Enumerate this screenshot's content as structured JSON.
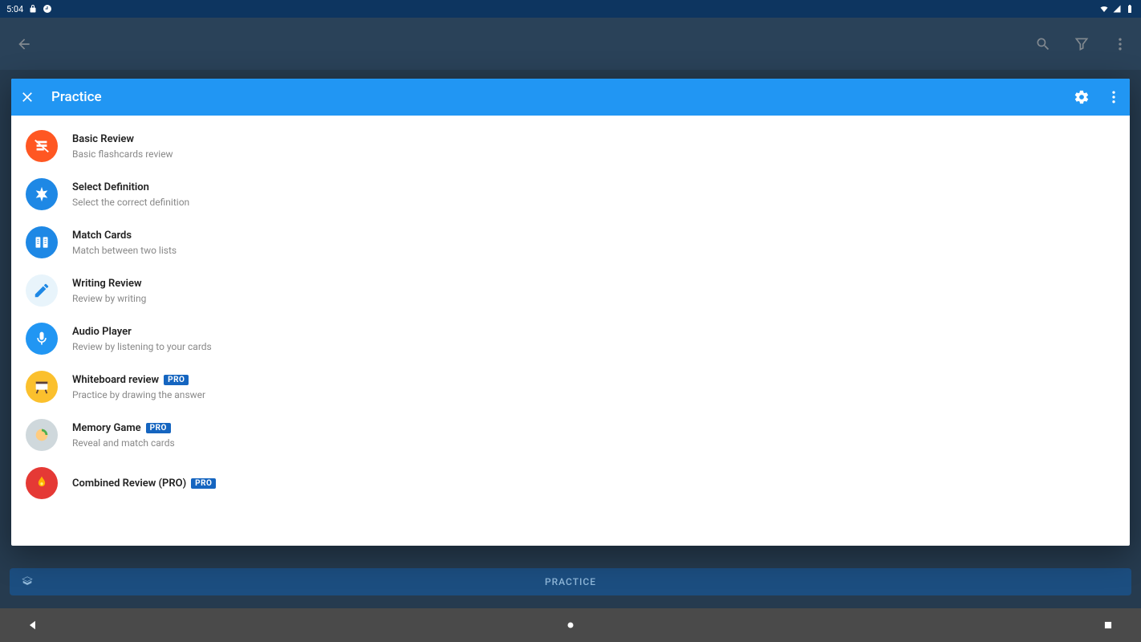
{
  "status": {
    "time": "5:04"
  },
  "dialog": {
    "title": "Practice",
    "items": [
      {
        "name": "basic-review",
        "title": "Basic Review",
        "sub": "Basic flashcards review",
        "iconClass": "ic-basic",
        "pro": false
      },
      {
        "name": "select-definition",
        "title": "Select Definition",
        "sub": "Select the correct definition",
        "iconClass": "ic-select",
        "pro": false
      },
      {
        "name": "match-cards",
        "title": "Match Cards",
        "sub": "Match between two lists",
        "iconClass": "ic-match",
        "pro": false
      },
      {
        "name": "writing-review",
        "title": "Writing Review",
        "sub": "Review by writing",
        "iconClass": "ic-writing",
        "pro": false
      },
      {
        "name": "audio-player",
        "title": "Audio Player",
        "sub": "Review by listening to your cards",
        "iconClass": "ic-audio",
        "pro": false
      },
      {
        "name": "whiteboard-review",
        "title": "Whiteboard review",
        "sub": "Practice by drawing the answer",
        "iconClass": "ic-white",
        "pro": true
      },
      {
        "name": "memory-game",
        "title": "Memory Game",
        "sub": "Reveal and match cards",
        "iconClass": "ic-memory",
        "pro": true
      },
      {
        "name": "combined-review",
        "title": "Combined Review (PRO)",
        "sub": "",
        "iconClass": "ic-comb",
        "pro": true
      }
    ],
    "pro_label": "PRO"
  },
  "practice_button": "PRACTICE"
}
